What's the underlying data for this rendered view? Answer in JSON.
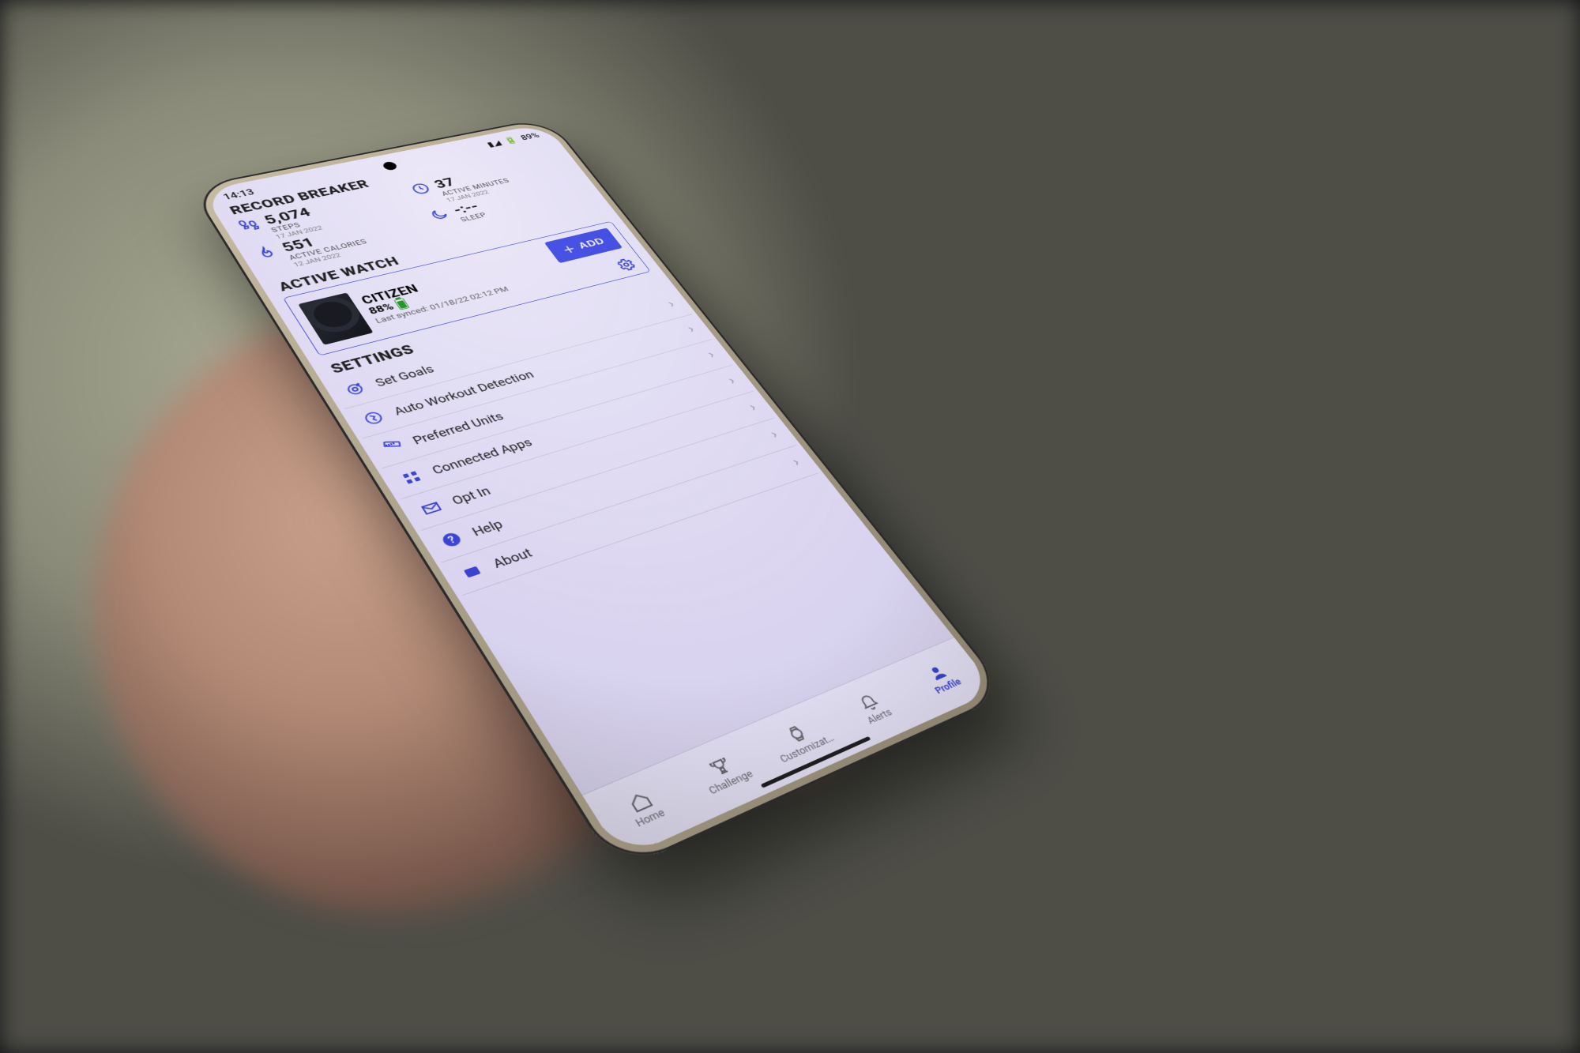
{
  "status": {
    "time": "14:13",
    "battery": "89%"
  },
  "header": {
    "title": "RECORD BREAKER"
  },
  "stats": {
    "steps": {
      "value": "5,074",
      "label": "STEPS",
      "date": "17 JAN 2022"
    },
    "minutes": {
      "value": "37",
      "label": "ACTIVE MINUTES",
      "date": "17 JAN 2022"
    },
    "cals": {
      "value": "551",
      "label": "ACTIVE CALORIES",
      "date": "12 JAN 2022"
    },
    "sleep": {
      "value": "-:--",
      "label": "SLEEP",
      "date": ""
    }
  },
  "active_watch": {
    "section": "ACTIVE WATCH",
    "name": "CITIZEN",
    "battery": "88%",
    "synced": "Last synced: 01/18/22 02:12 PM",
    "add": "ADD"
  },
  "settings": {
    "section": "SETTINGS",
    "items": [
      {
        "label": "Set Goals"
      },
      {
        "label": "Auto Workout Detection"
      },
      {
        "label": "Preferred Units"
      },
      {
        "label": "Connected Apps"
      },
      {
        "label": "Opt In"
      },
      {
        "label": "Help"
      },
      {
        "label": "About"
      }
    ]
  },
  "tabs": {
    "items": [
      {
        "label": "Home"
      },
      {
        "label": "Challenge"
      },
      {
        "label": "Customizat…"
      },
      {
        "label": "Alerts"
      },
      {
        "label": "Profile"
      }
    ],
    "active": 4
  }
}
